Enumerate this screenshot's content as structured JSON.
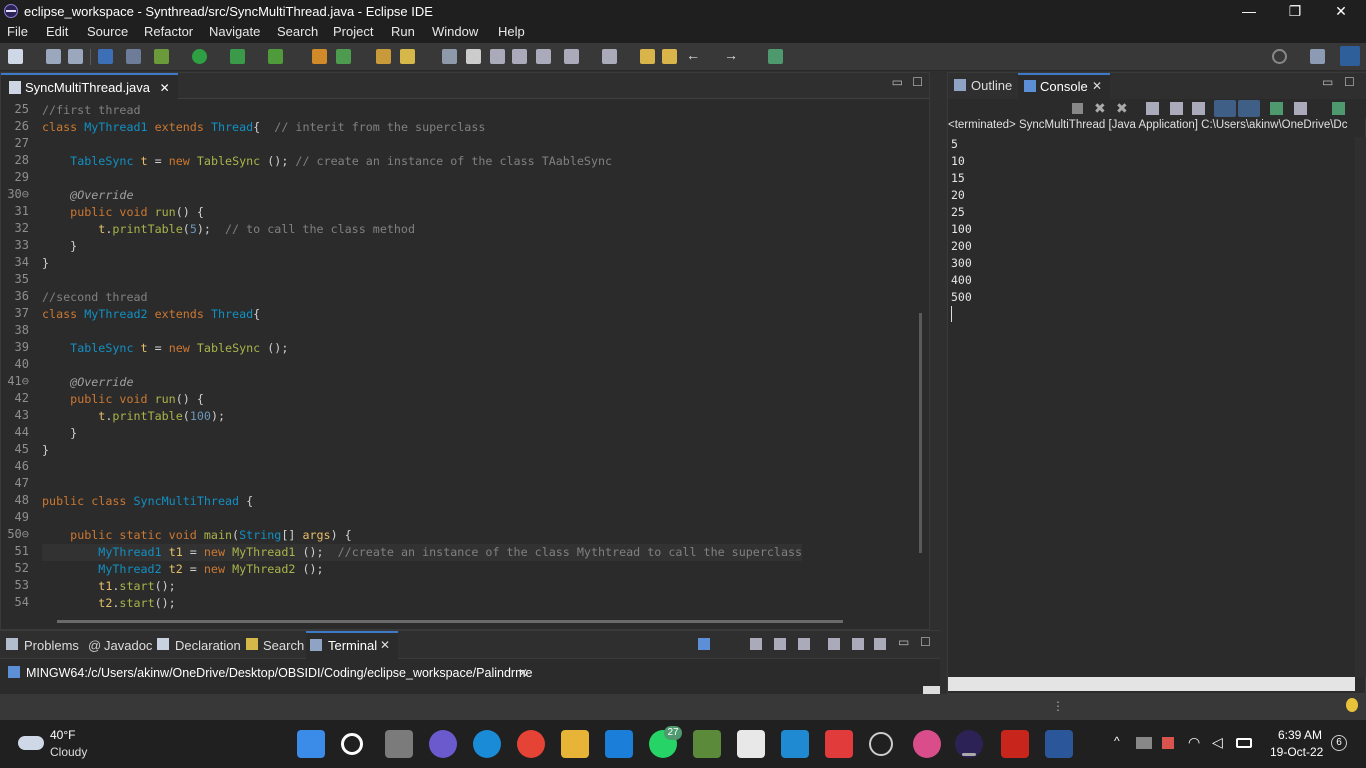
{
  "window": {
    "title": "eclipse_workspace - Synthread/src/SyncMultiThread.java - Eclipse IDE",
    "minimize": "—",
    "restore": "❐",
    "close": "✕"
  },
  "menu": [
    "File",
    "Edit",
    "Source",
    "Refactor",
    "Navigate",
    "Search",
    "Project",
    "Run",
    "Window",
    "Help"
  ],
  "editor": {
    "tab_label": "SyncMultiThread.java",
    "tab_close": "✕",
    "lines": [
      {
        "n": "25",
        "html": "<span class='cm'>//first thread</span>"
      },
      {
        "n": "26",
        "html": "<span class='kw'>class</span> <span class='cls'>MyThread1</span> <span class='kw'>extends</span> <span class='cls'>Thread</span>{  <span class='cm'>// interit from the superclass</span>"
      },
      {
        "n": "27",
        "html": ""
      },
      {
        "n": "28",
        "html": "    <span class='cls'>TableSync</span> <span class='var'>t</span> = <span class='kw'>new</span> <span class='fn'>TableSync</span> (); <span class='cm'>// create an instance of the class TAableSync</span>"
      },
      {
        "n": "29",
        "html": ""
      },
      {
        "n": "30⊖",
        "html": "    <span class='ann'>@Override</span>"
      },
      {
        "n": "31",
        "html": "    <span class='kw'>public void</span> <span class='fn'>run</span>() {"
      },
      {
        "n": "32",
        "html": "        <span class='var'>t</span>.<span class='fn'>printTable</span>(<span class='num'>5</span>);  <span class='cm'>// to call the class method</span>"
      },
      {
        "n": "33",
        "html": "    }"
      },
      {
        "n": "34",
        "html": "}"
      },
      {
        "n": "35",
        "html": ""
      },
      {
        "n": "36",
        "html": "<span class='cm'>//second thread</span>"
      },
      {
        "n": "37",
        "html": "<span class='kw'>class</span> <span class='cls'>MyThread2</span> <span class='kw'>extends</span> <span class='cls'>Thread</span>{"
      },
      {
        "n": "38",
        "html": ""
      },
      {
        "n": "39",
        "html": "    <span class='cls'>TableSync</span> <span class='var'>t</span> = <span class='kw'>new</span> <span class='fn'>TableSync</span> ();"
      },
      {
        "n": "40",
        "html": ""
      },
      {
        "n": "41⊖",
        "html": "    <span class='ann'>@Override</span>"
      },
      {
        "n": "42",
        "html": "    <span class='kw'>public void</span> <span class='fn'>run</span>() {"
      },
      {
        "n": "43",
        "html": "        <span class='var'>t</span>.<span class='fn'>printTable</span>(<span class='num'>100</span>);"
      },
      {
        "n": "44",
        "html": "    }"
      },
      {
        "n": "45",
        "html": "}"
      },
      {
        "n": "46",
        "html": ""
      },
      {
        "n": "47",
        "html": ""
      },
      {
        "n": "48",
        "html": "<span class='kw'>public class</span> <span class='cls'>SyncMultiThread</span> {"
      },
      {
        "n": "49",
        "html": ""
      },
      {
        "n": "50⊖",
        "html": "    <span class='kw'>public static void</span> <span class='fn'>main</span>(<span class='cls'>String</span>[] <span class='var'>args</span>) {"
      },
      {
        "n": "51",
        "html": "        <span class='cls'>MyThread1</span> <span class='var'>t1</span> = <span class='kw'>new</span> <span class='fn'>MyThread1</span> ();  <span class='cm'>//create an instance of the class Mythtread to call the superclass</span>"
      },
      {
        "n": "52",
        "html": "        <span class='cls'>MyThread2</span> <span class='var'>t2</span> = <span class='kw'>new</span> <span class='fn'>MyThread2</span> ();"
      },
      {
        "n": "53",
        "html": "        <span class='var'>t1</span>.<span class='fn'>start</span>();"
      },
      {
        "n": "54",
        "html": "        <span class='var'>t2</span>.<span class='fn'>start</span>();"
      }
    ]
  },
  "bottom": {
    "tabs": [
      "Problems",
      "Javadoc",
      "Declaration",
      "Search",
      "Terminal"
    ],
    "terminal_tab": "MINGW64:/c/Users/akinw/OneDrive/Desktop/OBSIDI/Coding/eclipse_workspace/Palindrme",
    "close": "✕"
  },
  "right": {
    "tabs": [
      "Outline",
      "Console"
    ],
    "close": "✕",
    "console_header": "<terminated> SyncMultiThread [Java Application] C:\\Users\\akinw\\OneDrive\\Dc",
    "output": [
      "5",
      "10",
      "15",
      "20",
      "25",
      "100",
      "200",
      "300",
      "400",
      "500"
    ]
  },
  "taskbar": {
    "weather_temp": "40°F",
    "weather_desc": "Cloudy",
    "time": "6:39 AM",
    "date": "19-Oct-22",
    "notif_count": "6",
    "whatsapp_badge": "27"
  }
}
